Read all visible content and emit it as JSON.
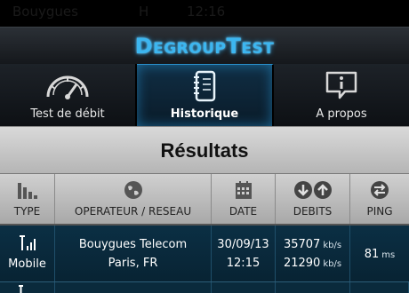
{
  "statusbar": {
    "carrier": "Bouygues",
    "network": "H",
    "time": "12:16"
  },
  "app": {
    "title": "DegroupTest"
  },
  "tabs": [
    {
      "label": "Test de débit",
      "icon": "speedometer-icon",
      "active": false
    },
    {
      "label": "Historique",
      "icon": "notebook-icon",
      "active": true
    },
    {
      "label": "A propos",
      "icon": "info-bubble-icon",
      "active": false
    }
  ],
  "results": {
    "title": "Résultats"
  },
  "columns": [
    {
      "label": "TYPE",
      "icon": "signal-bars-icon"
    },
    {
      "label": "OPERATEUR / RESEAU",
      "icon": "globe-icon"
    },
    {
      "label": "DATE",
      "icon": "calendar-icon"
    },
    {
      "label": "DEBITS",
      "icon": "down-up-arrows-icon"
    },
    {
      "label": "PING",
      "icon": "exchange-arrows-icon"
    }
  ],
  "rows": [
    {
      "type": "Mobile",
      "type_icon": "mobile-signal-icon",
      "operator": "Bouygues Telecom",
      "location": "Paris, FR",
      "date": "30/09/13",
      "time": "12:15",
      "download": "35707",
      "upload": "21290",
      "rate_unit": "kb/s",
      "ping": "81",
      "ping_unit": "ms"
    }
  ],
  "colors": {
    "accent": "#3cb6f0",
    "row_bg": "#0b2f44",
    "header_bg": "#c4c4c4"
  }
}
